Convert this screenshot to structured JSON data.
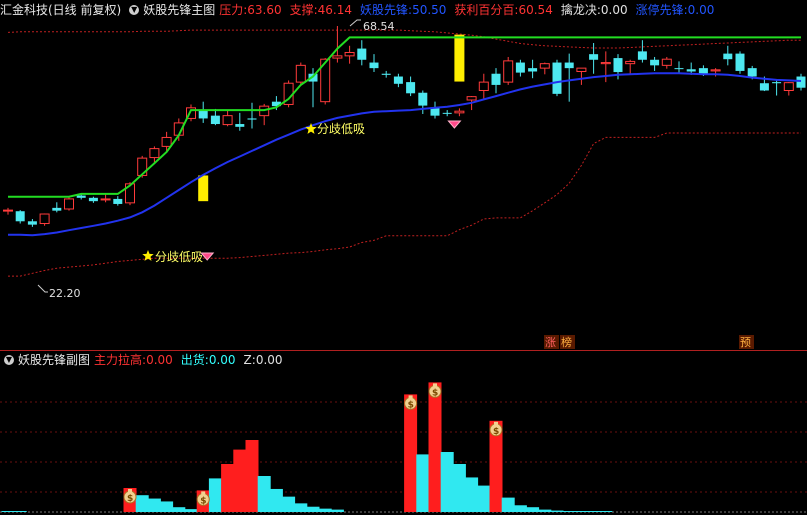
{
  "main_header": {
    "stock": "汇金科技(日线 前复权)",
    "indicator": "妖股先锋主图",
    "items": [
      {
        "label": "压力:",
        "value": "63.60",
        "color": "#ff3333",
        "vcolor": "#ff3333"
      },
      {
        "label": "支撑:",
        "value": "46.14",
        "color": "#ff3333",
        "vcolor": "#ff3333"
      },
      {
        "label": "妖股先锋:",
        "value": "50.50",
        "color": "#2255ff",
        "vcolor": "#2255ff"
      },
      {
        "label": "获利百分百:",
        "value": "60.54",
        "color": "#ff3333",
        "vcolor": "#ff3333"
      },
      {
        "label": "擒龙决:",
        "value": "0.00",
        "color": "#e0e0e0",
        "vcolor": "#e0e0e0"
      },
      {
        "label": "涨停先锋:",
        "value": "0.00",
        "color": "#2255ff",
        "vcolor": "#2255ff"
      }
    ]
  },
  "sub_header": {
    "indicator": "妖股先锋副图",
    "items": [
      {
        "label": "主力拉高:",
        "value": "0.00",
        "color": "#ff3333"
      },
      {
        "label": "出货:",
        "value": "0.00",
        "color": "#33ffff"
      },
      {
        "label": "Z:",
        "value": "0.00",
        "color": "#e0e0e0"
      }
    ]
  },
  "annotations": {
    "high_price": "68.54",
    "low_price": "22.20",
    "signal_text": "分歧低吸",
    "signal_text_2": "分歧低吸",
    "zhang_label": "涨",
    "bang_label": "榜",
    "yu_label": "预"
  },
  "chart_data": [
    {
      "type": "candlestick",
      "title": "妖股先锋主图",
      "price_range": [
        22.2,
        68.54
      ],
      "candles": [
        [
          35.5,
          36.0,
          34.8,
          35.6
        ],
        [
          35.4,
          35.6,
          33.2,
          33.6
        ],
        [
          33.6,
          34.0,
          32.6,
          33.0
        ],
        [
          33.2,
          35.0,
          32.8,
          34.9
        ],
        [
          36.0,
          37.0,
          35.2,
          35.5
        ],
        [
          35.8,
          38.0,
          35.5,
          37.6
        ],
        [
          38.2,
          38.6,
          37.5,
          37.8
        ],
        [
          37.8,
          38.0,
          36.9,
          37.2
        ],
        [
          37.6,
          38.6,
          37.0,
          37.6
        ],
        [
          37.6,
          38.1,
          36.4,
          36.7
        ],
        [
          36.9,
          40.6,
          36.5,
          40.3
        ],
        [
          41.8,
          45.3,
          41.4,
          44.9
        ],
        [
          45.0,
          47.0,
          44.0,
          46.6
        ],
        [
          47.0,
          49.6,
          46.0,
          48.6
        ],
        [
          49.0,
          52.0,
          48.0,
          51.2
        ],
        [
          52.0,
          54.5,
          51.5,
          53.9
        ],
        [
          53.5,
          55.0,
          51.2,
          52.0
        ],
        [
          52.5,
          53.7,
          50.8,
          51.0
        ],
        [
          50.9,
          53.4,
          50.6,
          52.5
        ],
        [
          51.0,
          53.0,
          49.8,
          50.5
        ],
        [
          52.0,
          54.8,
          50.2,
          51.8
        ],
        [
          52.5,
          54.6,
          50.8,
          54.2
        ],
        [
          55.0,
          56.0,
          53.5,
          54.2
        ],
        [
          54.5,
          58.8,
          54.0,
          58.3
        ],
        [
          58.5,
          62.0,
          58.0,
          61.5
        ],
        [
          60.0,
          61.0,
          54.0,
          58.6
        ],
        [
          55.0,
          62.8,
          54.5,
          62.6
        ],
        [
          62.8,
          68.54,
          62.0,
          63.2
        ],
        [
          63.2,
          65.0,
          61.8,
          63.8
        ],
        [
          64.5,
          66.0,
          61.5,
          62.5
        ],
        [
          62.0,
          63.5,
          60.3,
          61.0
        ],
        [
          60.0,
          60.5,
          59.3,
          59.8
        ],
        [
          59.5,
          60.0,
          57.6,
          58.2
        ],
        [
          58.5,
          59.5,
          56.0,
          56.5
        ],
        [
          56.6,
          57.0,
          52.8,
          54.3
        ],
        [
          54.0,
          55.0,
          52.0,
          52.5
        ],
        [
          53.0,
          53.5,
          52.4,
          52.9
        ],
        [
          53.0,
          53.8,
          52.4,
          53.3
        ],
        [
          55.3,
          56.0,
          53.5,
          55.9
        ],
        [
          57.0,
          60.0,
          55.5,
          58.5
        ],
        [
          60.0,
          61.0,
          56.5,
          58.0
        ],
        [
          58.5,
          63.0,
          58.0,
          62.3
        ],
        [
          62.0,
          62.5,
          59.5,
          60.2
        ],
        [
          61.0,
          62.5,
          59.2,
          60.4
        ],
        [
          61.0,
          62.0,
          59.9,
          61.8
        ],
        [
          62.0,
          62.5,
          56.0,
          56.4
        ],
        [
          62.0,
          63.6,
          55.0,
          61.0
        ],
        [
          60.4,
          61.0,
          58.0,
          61.0
        ],
        [
          63.5,
          65.5,
          60.0,
          62.5
        ],
        [
          61.8,
          64.0,
          58.5,
          62.0
        ],
        [
          62.8,
          63.5,
          59.0,
          60.3
        ],
        [
          61.8,
          62.5,
          59.9,
          62.2
        ],
        [
          64.0,
          66.0,
          62.0,
          62.5
        ],
        [
          62.5,
          63.0,
          60.5,
          61.5
        ],
        [
          61.5,
          63.0,
          60.9,
          62.6
        ],
        [
          61.0,
          62.2,
          60.2,
          60.9
        ],
        [
          60.8,
          62.0,
          59.8,
          60.4
        ],
        [
          61.0,
          61.5,
          59.6,
          60.0
        ],
        [
          60.5,
          61.0,
          59.5,
          60.7
        ],
        [
          63.6,
          65.0,
          61.5,
          62.6
        ],
        [
          63.6,
          64.0,
          60.0,
          60.5
        ],
        [
          61.0,
          61.4,
          59.0,
          59.5
        ],
        [
          58.3,
          59.5,
          56.9,
          57.0
        ],
        [
          58.5,
          59.0,
          56.1,
          58.3
        ],
        [
          57.0,
          58.5,
          56.1,
          58.4
        ],
        [
          59.5,
          60.0,
          57.0,
          57.5
        ]
      ],
      "series": [
        {
          "name": "妖股先锋",
          "values": [
            31.2,
            31.2,
            31.1,
            31.3,
            31.6,
            32.0,
            32.4,
            32.8,
            33.2,
            33.7,
            34.3,
            35.2,
            36.4,
            37.8,
            39.2,
            40.6,
            41.9,
            43.1,
            44.2,
            45.2,
            46.2,
            47.2,
            48.2,
            49.1,
            50.0,
            50.8,
            51.5,
            52.1,
            52.5,
            52.9,
            53.2,
            53.3,
            53.4,
            53.5,
            53.7,
            53.9,
            54.1,
            54.4,
            54.8,
            55.4,
            56.0,
            56.6,
            57.2,
            57.7,
            58.1,
            58.5,
            58.8,
            59.1,
            59.4,
            59.6,
            59.8,
            59.9,
            60.0,
            60.1,
            60.1,
            60.1,
            60.0,
            59.9,
            59.9,
            59.8,
            59.6,
            59.3,
            59.1,
            58.9,
            58.8,
            58.7
          ]
        },
        {
          "name": "支撑",
          "values": [
            38.0,
            38.0,
            38.0,
            38.0,
            38.0,
            38.0,
            38.5,
            38.5,
            38.5,
            38.5,
            40.0,
            42.0,
            44.0,
            46.0,
            49.0,
            53.5,
            53.5,
            53.5,
            53.5,
            53.5,
            53.5,
            53.5,
            54.0,
            55.5,
            58.0,
            59.5,
            62.0,
            64.5,
            66.5,
            66.5,
            66.5,
            66.5,
            66.5,
            66.5,
            66.5,
            66.5,
            66.5,
            66.5,
            66.5,
            66.5,
            66.5,
            66.5,
            66.5,
            66.5,
            66.5,
            66.5,
            66.5,
            66.5,
            66.5,
            66.5,
            66.5,
            66.5,
            66.5,
            66.5,
            66.5,
            66.5,
            66.5,
            66.5,
            66.5,
            66.5,
            66.5,
            66.5,
            66.5,
            66.5,
            66.5,
            66.5
          ]
        },
        {
          "name": "获利百分百",
          "values": [
            23.8,
            23.8,
            24.3,
            24.8,
            25.2,
            25.4,
            25.6,
            25.8,
            26.1,
            26.4,
            26.6,
            26.8,
            27.0,
            27.0,
            27.0,
            27.0,
            27.0,
            27.0,
            27.0,
            27.1,
            27.3,
            27.5,
            27.7,
            27.9,
            28.0,
            28.2,
            28.5,
            28.7,
            29.0,
            29.8,
            30.2,
            31.0,
            31.0,
            31.0,
            31.0,
            31.0,
            31.0,
            32.1,
            32.9,
            34.0,
            34.2,
            34.2,
            34.2,
            35.5,
            36.9,
            38.4,
            40.4,
            43.6,
            47.5,
            48.6,
            48.6,
            48.6,
            48.6,
            48.6,
            49.4,
            49.4,
            49.4,
            49.4,
            49.4,
            49.4,
            49.4,
            49.4,
            49.4,
            49.4,
            49.4,
            49.4
          ]
        },
        {
          "name": "压力",
          "values": [
            67.4,
            67.5,
            67.5,
            67.5,
            67.5,
            67.5,
            67.5,
            67.5,
            67.5,
            67.5,
            67.5,
            67.6,
            67.6,
            67.6,
            67.7,
            67.8,
            67.8,
            67.8,
            67.8,
            67.8,
            67.8,
            67.8,
            67.8,
            67.8,
            67.8,
            67.8,
            67.8,
            67.8,
            67.8,
            67.8,
            67.8,
            67.8,
            67.8,
            67.7,
            67.6,
            67.5,
            67.3,
            67.1,
            66.9,
            66.6,
            66.2,
            65.8,
            65.4,
            65.2,
            65.0,
            64.9,
            64.8,
            64.7,
            64.6,
            64.6,
            64.6,
            64.7,
            64.8,
            64.9,
            65.0,
            65.1,
            65.2,
            65.3,
            65.4,
            65.5,
            65.6,
            65.7,
            65.8,
            65.9,
            66.0,
            66.0
          ]
        }
      ],
      "signal_bars": [
        {
          "index": 16,
          "low": 37.2,
          "high": 41.8
        },
        {
          "index": 37,
          "low": 58.6,
          "high": 67.0
        }
      ],
      "diamond_marks": [
        16,
        37
      ]
    },
    {
      "type": "bar",
      "title": "妖股先锋副图",
      "series": [
        {
          "name": "主力拉高",
          "values": [
            0,
            0,
            0,
            0,
            0,
            0,
            0,
            0,
            0,
            0,
            0.5,
            0,
            0,
            0,
            0,
            0,
            0.45,
            0,
            1.0,
            1.3,
            1.5,
            0,
            0,
            0,
            0,
            0,
            0,
            0,
            0,
            0,
            0,
            0,
            0,
            2.45,
            0,
            2.7,
            0,
            0,
            0,
            0,
            1.9,
            0,
            0,
            0,
            0,
            0,
            0,
            0,
            0,
            0,
            0,
            0,
            0,
            0,
            0,
            0,
            0,
            0,
            0,
            0,
            0,
            0,
            0,
            0,
            0,
            0
          ]
        },
        {
          "name": "出货",
          "values": [
            0.02,
            0.02,
            0,
            0,
            0,
            0,
            0,
            0,
            0,
            0,
            0,
            0.35,
            0.28,
            0.22,
            0.1,
            0.06,
            0,
            0.7,
            0,
            0,
            0,
            0.75,
            0.48,
            0.32,
            0.18,
            0.11,
            0.07,
            0.05,
            0,
            0,
            0,
            0,
            0,
            0,
            1.2,
            0,
            1.25,
            1.0,
            0.72,
            0.55,
            0,
            0.3,
            0.14,
            0.1,
            0.05,
            0.03,
            0.02,
            0.02,
            0.01,
            0.01,
            0,
            0,
            0,
            0,
            0,
            0,
            0,
            0,
            0,
            0,
            0,
            0,
            0,
            0,
            0,
            0
          ]
        }
      ],
      "money_bags": [
        10,
        16,
        33,
        35,
        40
      ]
    }
  ]
}
